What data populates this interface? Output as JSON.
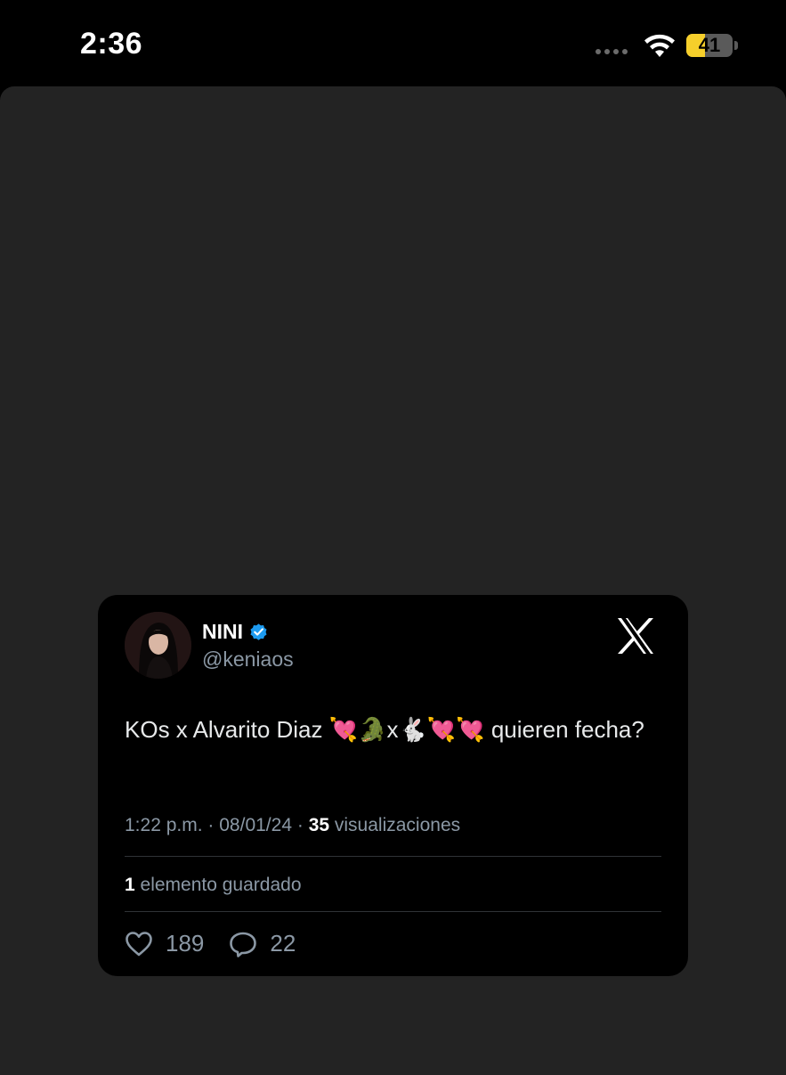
{
  "status_bar": {
    "time": "2:36",
    "battery_level": "41",
    "battery_fraction": 0.41,
    "battery_color": "#f6cf2b"
  },
  "tweet": {
    "display_name": "NINI",
    "handle": "@keniaos",
    "text": "KOs x Alvarito Diaz 💘🐊x🐇💘💘 quieren fecha?",
    "time": "1:22 p.m.",
    "separator": "·",
    "date": "08/01/24",
    "views_count": "35",
    "views_label": "visualizaciones",
    "saved_count": "1",
    "saved_label": "elemento guardado",
    "likes": "189",
    "replies": "22",
    "verified_color": "#1d9bf0"
  },
  "icons": {
    "wifi": "wifi-icon",
    "verified": "verified-badge-icon",
    "brand": "x-logo-icon",
    "like": "heart-icon",
    "reply": "reply-bubble-icon"
  }
}
